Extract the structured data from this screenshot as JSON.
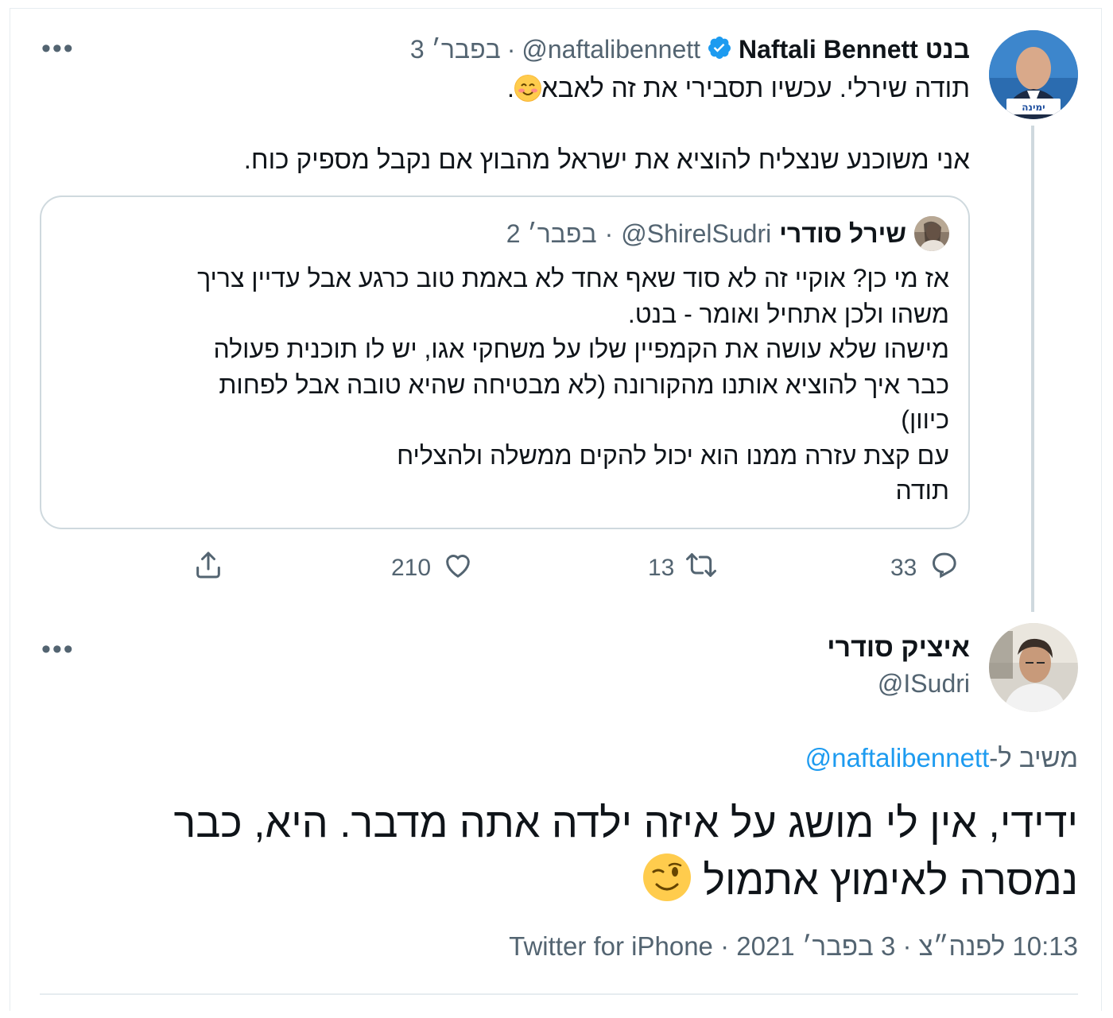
{
  "tweet1": {
    "name": "Naftali Bennett בנט",
    "handle": "@naftalibennett",
    "separator": "·",
    "date": "3 בפבר׳",
    "line1": "תודה שירלי. עכשיו תסבירי את זה לאבא",
    "line1_end": ".",
    "line2": "אני משוכנע שנצליח להוציא את ישראל מהבוץ אם נקבל מספיק כוח.",
    "more": "•••"
  },
  "quote": {
    "name": "שירל סודרי",
    "handle": "@ShirelSudri",
    "separator": "·",
    "date": "2 בפבר׳",
    "text": "אז מי כן? אוקיי זה לא סוד שאף אחד לא באמת טוב כרגע אבל עדיין צריך\nמשהו ולכן אתחיל ואומר - בנט.\nמישהו שלא עושה את הקמפיין שלו על משחקי אגו, יש לו תוכנית פעולה\nכבר איך להוציא אותנו מהקורונה (לא מבטיחה שהיא טובה אבל לפחות\nכיוון)\nעם קצת עזרה ממנו הוא יכול להקים ממשלה ולהצליח\nתודה"
  },
  "actions": {
    "replies": "33",
    "retweets": "13",
    "likes": "210"
  },
  "tweet2": {
    "name": "איציק סודרי",
    "handle": "@ISudri",
    "more": "•••",
    "reply_prefix": "משיב ל-",
    "reply_to": "@naftalibennett",
    "text_line1": "ידידי, אין לי מושג על איזה ילדה אתה מדבר. היא, כבר",
    "text_line2": "נמסרה לאימוץ אתמול",
    "time": "10:13 לפנה״צ",
    "date": "3 בפבר׳ 2021",
    "source": "Twitter for iPhone",
    "separator": "·"
  },
  "colors": {
    "text": "#0f1419",
    "secondary": "#536471",
    "link": "#1d9bf0",
    "border": "#cfd9de"
  }
}
